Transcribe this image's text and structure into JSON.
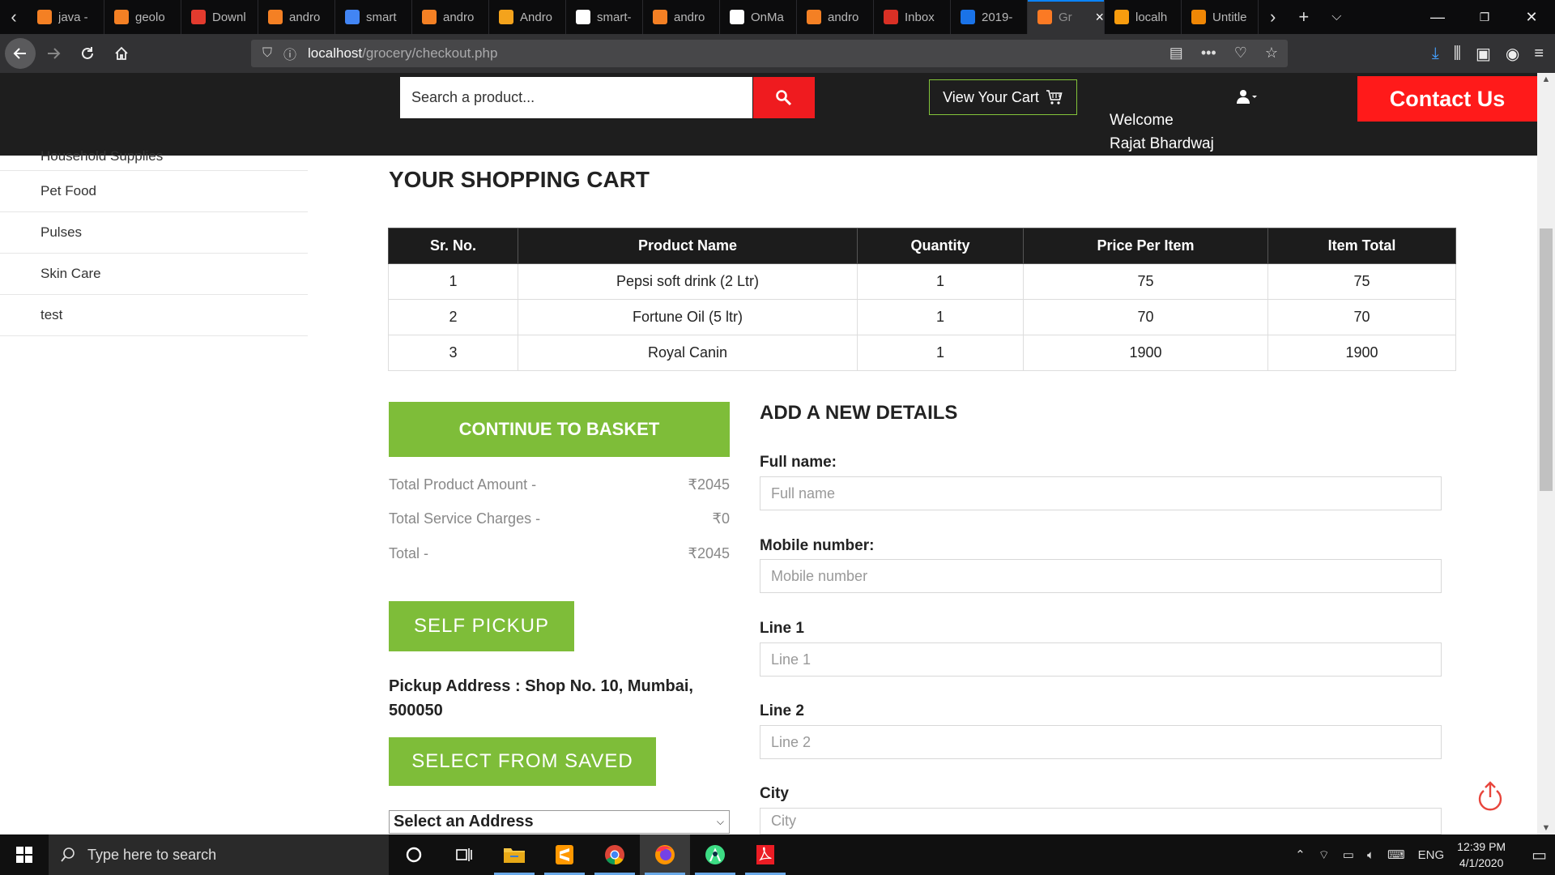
{
  "browser": {
    "tabs": [
      {
        "title": "java -",
        "icon": "stackoverflow-icon",
        "color": "#f48024"
      },
      {
        "title": "geolo",
        "icon": "stackoverflow-icon",
        "color": "#f48024"
      },
      {
        "title": "Downl",
        "icon": "download-site-icon",
        "color": "#e33b2e"
      },
      {
        "title": "andro",
        "icon": "stackoverflow-icon",
        "color": "#f48024"
      },
      {
        "title": "smart",
        "icon": "google-icon",
        "color": "#4285f4"
      },
      {
        "title": "andro",
        "icon": "stackoverflow-icon",
        "color": "#f48024"
      },
      {
        "title": "Andro",
        "icon": "java-icon",
        "color": "#f4a31c"
      },
      {
        "title": "smart-",
        "icon": "github-icon",
        "color": "#ffffff"
      },
      {
        "title": "andro",
        "icon": "stackoverflow-icon",
        "color": "#f48024"
      },
      {
        "title": "OnMa",
        "icon": "onmap-icon",
        "color": "#ffffff"
      },
      {
        "title": "andro",
        "icon": "stackoverflow-icon",
        "color": "#f48024"
      },
      {
        "title": "Inbox",
        "icon": "gmail-icon",
        "color": "#d93025"
      },
      {
        "title": "2019-",
        "icon": "contacts-icon",
        "color": "#1a73e8"
      },
      {
        "title": "Gr",
        "icon": "xampp-icon",
        "color": "#fb7a24",
        "active": true
      },
      {
        "title": "localh",
        "icon": "phpmyadmin-icon",
        "color": "#f89c0e"
      },
      {
        "title": "Untitle",
        "icon": "draw-icon",
        "color": "#f08705"
      }
    ],
    "url_host": "localhost",
    "url_path": "/grocery/checkout.php"
  },
  "header": {
    "search_placeholder": "Search a product...",
    "cart_label": "View Your Cart",
    "welcome_line1": "Welcome",
    "welcome_line2": "Rajat Bhardwaj",
    "contact_label": "Contact Us"
  },
  "sidebar": {
    "items": [
      "Household Supplies",
      "Pet Food",
      "Pulses",
      "Skin Care",
      "test"
    ]
  },
  "cart": {
    "title": "YOUR SHOPPING CART",
    "columns": [
      "Sr. No.",
      "Product Name",
      "Quantity",
      "Price Per Item",
      "Item Total"
    ],
    "rows": [
      [
        "1",
        "Pepsi soft drink (2 Ltr)",
        "1",
        "75",
        "75"
      ],
      [
        "2",
        "Fortune Oil (5 ltr)",
        "1",
        "70",
        "70"
      ],
      [
        "3",
        "Royal Canin",
        "1",
        "1900",
        "1900"
      ]
    ]
  },
  "summary": {
    "continue_label": "CONTINUE TO BASKET",
    "product_amount_label": "Total Product Amount -",
    "product_amount_value": "₹2045",
    "service_label": "Total Service Charges -",
    "service_value": "₹0",
    "total_label": "Total -",
    "total_value": "₹2045",
    "self_pickup_label": "SELF PICKUP",
    "pickup_address": "Pickup Address : Shop No. 10, Mumbai, 500050",
    "select_saved_label": "SELECT FROM SAVED",
    "address_select_value": "Select an Address"
  },
  "form": {
    "title": "ADD A NEW DETAILS",
    "full_name_label": "Full name:",
    "full_name_placeholder": "Full name",
    "mobile_label": "Mobile number:",
    "mobile_placeholder": "Mobile number",
    "line1_label": "Line 1",
    "line1_placeholder": "Line 1",
    "line2_label": "Line 2",
    "line2_placeholder": "Line 2",
    "city_label": "City",
    "city_placeholder": "City"
  },
  "taskbar": {
    "search_placeholder": "Type here to search",
    "language": "ENG",
    "time": "12:39 PM",
    "date": "4/1/2020"
  },
  "colors": {
    "accent_green": "#7ebd39",
    "accent_red": "#ef1b1f",
    "header_dark": "#1e1e1e"
  }
}
